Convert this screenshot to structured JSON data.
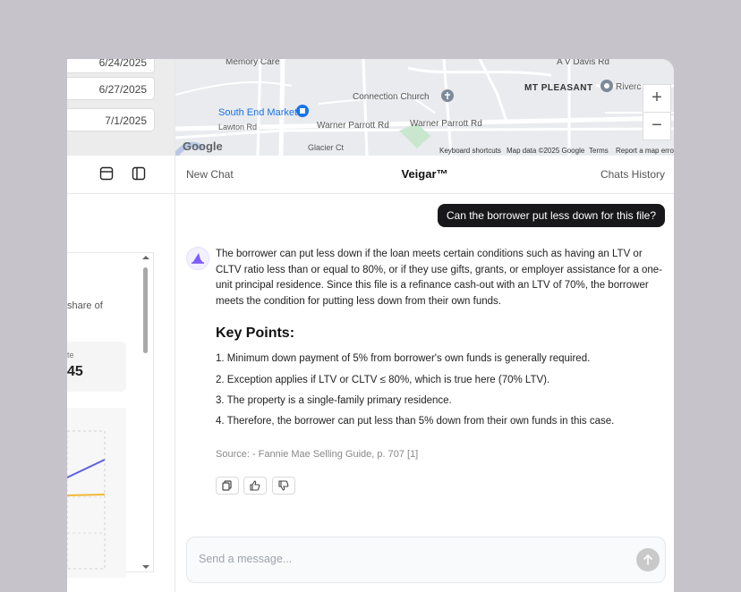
{
  "left": {
    "dates": [
      "6/24/2025",
      "6/27/2025",
      "7/1/2025"
    ],
    "share_text": "share of",
    "stat_label": "te",
    "stat_value": "45"
  },
  "map": {
    "labels": {
      "memory_care": "Memory Care",
      "av_davis": "A V Davis Rd",
      "mt_pleasant": "MT PLEASANT",
      "riverc": "Riverc",
      "connection_church": "Connection Church",
      "south_end_market": "South End Market",
      "lawton": "Lawton Rd",
      "warner1": "Warner Parrott Rd",
      "warner2": "Warner Parrott Rd",
      "glacier": "Glacier Ct",
      "keyboard": "Keyboard shortcuts",
      "mapdata": "Map data ©2025 Google",
      "terms": "Terms",
      "report": "Report a map error",
      "google": "Google"
    },
    "zoom_in": "+",
    "zoom_out": "−"
  },
  "chat": {
    "new_chat": "New Chat",
    "title": "Veigar™",
    "history": "Chats History",
    "user_message": "Can the borrower put less down for this file?",
    "answer": "The borrower can put less down if the loan meets certain conditions such as having an LTV or CLTV ratio less than or equal to 80%, or if they use gifts, grants, or employer assistance for a one-unit principal residence. Since this file is a refinance cash-out with an LTV of 70%, the borrower meets the condition for putting less down from their own funds.",
    "key_points_title": "Key Points:",
    "points": [
      "1. Minimum down payment of 5% from borrower's own funds is generally required.",
      "2. Exception applies if LTV or CLTV ≤ 80%, which is true here (70% LTV).",
      "3. The property is a single-family primary residence.",
      "4. Therefore, the borrower can put less than 5% down from their own funds in this case."
    ],
    "source": "Source: - Fannie Mae Selling Guide, p. 707 [1]",
    "input_placeholder": "Send a message..."
  },
  "colors": {
    "accent": "#18181b",
    "line1": "#5b61e6",
    "line2": "#f1b838"
  }
}
